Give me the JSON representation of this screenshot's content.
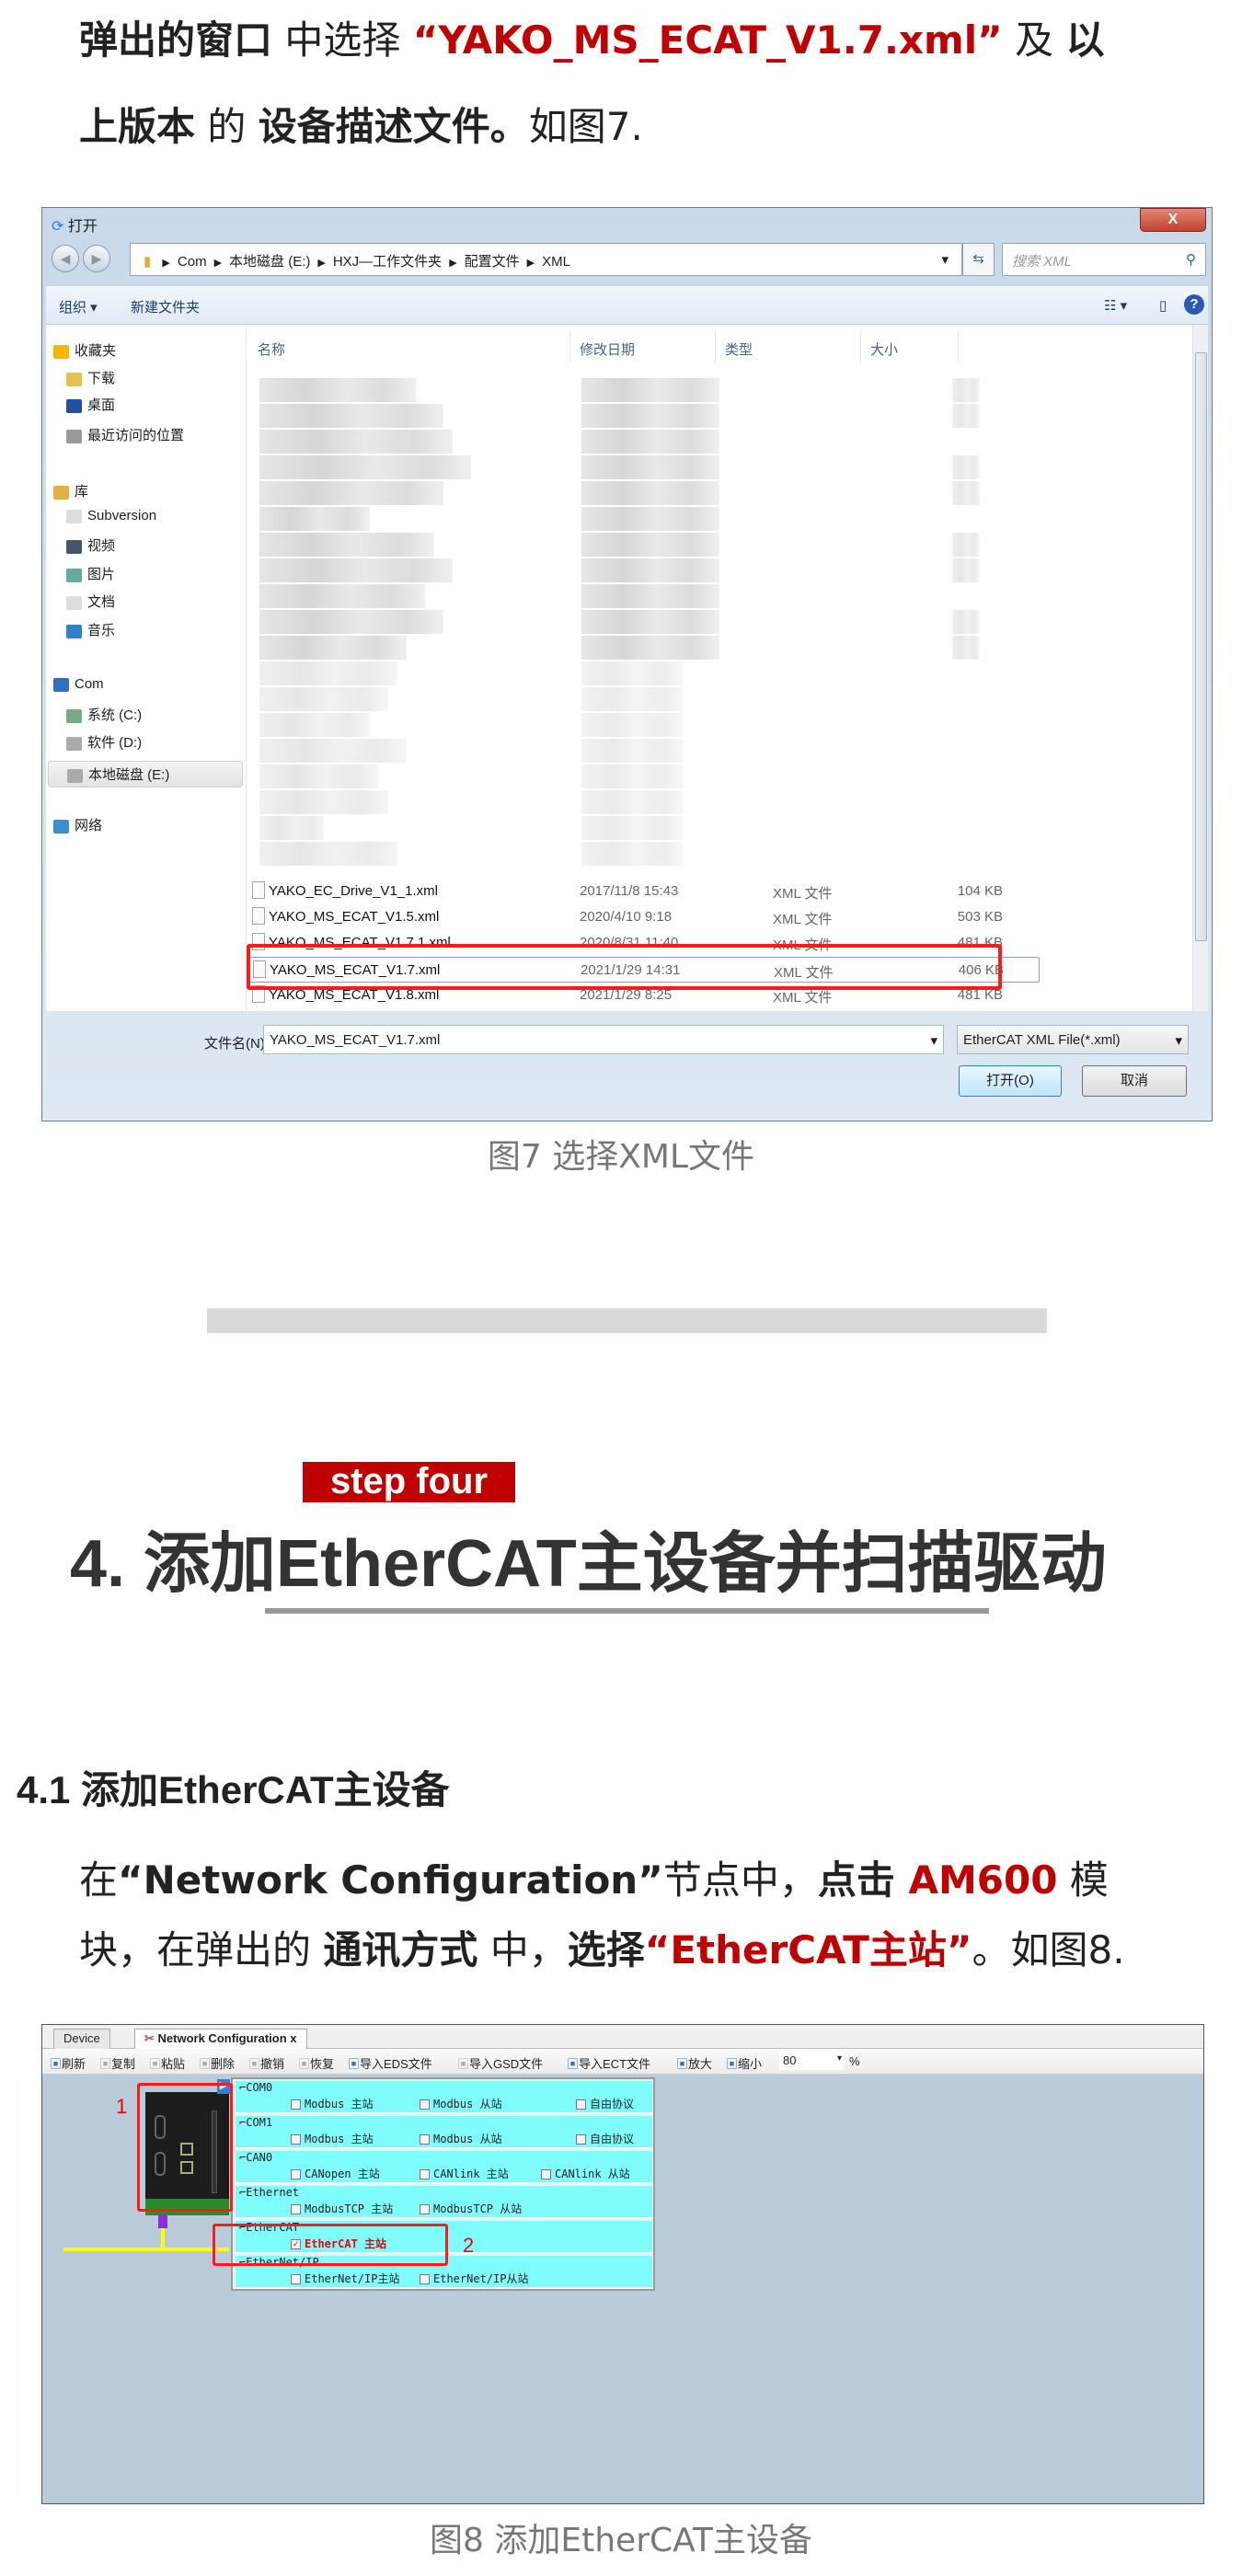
{
  "intro": {
    "line1": [
      {
        "t": "弹出的窗口",
        "s": "b"
      },
      {
        "t": " 中选择 ",
        "s": ""
      },
      {
        "t": "“YAKO_MS_ECAT_V1.7.xml”",
        "s": "red"
      },
      {
        "t": " 及 ",
        "s": ""
      },
      {
        "t": "以",
        "s": "b"
      }
    ],
    "line2": [
      {
        "t": "上版本",
        "s": "b"
      },
      {
        "t": " 的 ",
        "s": ""
      },
      {
        "t": "设备描述文件。",
        "s": "b"
      },
      {
        "t": "如图7.",
        "s": ""
      }
    ]
  },
  "dialog": {
    "title": "打开",
    "close": "X",
    "breadcrumb": [
      "Com",
      "本地磁盘 (E:)",
      "HXJ—工作文件夹",
      "配置文件",
      "XML"
    ],
    "search_placeholder": "搜索 XML",
    "toolbar": {
      "organize": "组织 ▾",
      "new_folder": "新建文件夹"
    },
    "nav": [
      {
        "label": "收藏夹",
        "icon": "star-icon",
        "level": 0
      },
      {
        "label": "下载",
        "icon": "download-folder-icon",
        "level": 1
      },
      {
        "label": "桌面",
        "icon": "desktop-icon",
        "level": 1
      },
      {
        "label": "最近访问的位置",
        "icon": "recent-places-icon",
        "level": 1
      },
      {
        "label": "库",
        "icon": "library-icon",
        "level": 0
      },
      {
        "label": "Subversion",
        "icon": "document-icon",
        "level": 1
      },
      {
        "label": "视频",
        "icon": "video-icon",
        "level": 1
      },
      {
        "label": "图片",
        "icon": "picture-icon",
        "level": 1
      },
      {
        "label": "文档",
        "icon": "document-icon",
        "level": 1
      },
      {
        "label": "音乐",
        "icon": "music-icon",
        "level": 1
      },
      {
        "label": "Com",
        "icon": "computer-icon",
        "level": 0
      },
      {
        "label": "系统 (C:)",
        "icon": "system-drive-icon",
        "level": 1
      },
      {
        "label": "软件 (D:)",
        "icon": "drive-icon",
        "level": 1
      },
      {
        "label": "本地磁盘 (E:)",
        "icon": "drive-icon",
        "level": 1,
        "selected": true
      },
      {
        "label": "网络",
        "icon": "network-icon",
        "level": 0
      }
    ],
    "columns": [
      "名称",
      "修改日期",
      "类型",
      "大小"
    ],
    "files": [
      {
        "name": "YAKO_EC_Drive_V1_1.xml",
        "date": "2017/11/8 15:43",
        "type": "XML 文件",
        "size": "104 KB"
      },
      {
        "name": "YAKO_MS_ECAT_V1.5.xml",
        "date": "2020/4/10 9:18",
        "type": "XML 文件",
        "size": "503 KB"
      },
      {
        "name": "YAKO_MS_ECAT_V1.7.1.xml",
        "date": "2020/8/31 11:40",
        "type": "XML 文件",
        "size": "481 KB"
      },
      {
        "name": "YAKO_MS_ECAT_V1.7.xml",
        "date": "2021/1/29 14:31",
        "type": "XML 文件",
        "size": "406 KB",
        "selected": true
      },
      {
        "name": "YAKO_MS_ECAT_V1.8.xml",
        "date": "2021/1/29 8:25",
        "type": "XML 文件",
        "size": "481 KB"
      }
    ],
    "filename_label": "文件名(N):",
    "filename_value": "YAKO_MS_ECAT_V1.7.xml",
    "filetype": "EtherCAT  XML  File(*.xml)",
    "open": "打开(O)",
    "cancel": "取消"
  },
  "caption7": "图7 选择XML文件",
  "step_label": "step four",
  "heading": "4. 添加EtherCAT主设备并扫描驱动",
  "subheading": "4.1 添加EtherCAT主设备",
  "para": {
    "line1": [
      {
        "t": "在",
        "s": ""
      },
      {
        "t": "“Network Configuration”",
        "s": "b"
      },
      {
        "t": "节点中，",
        "s": ""
      },
      {
        "t": "点击 ",
        "s": "b"
      },
      {
        "t": "AM600",
        "s": "red"
      },
      {
        "t": " 模",
        "s": ""
      }
    ],
    "line2": [
      {
        "t": "块，在弹出的 ",
        "s": ""
      },
      {
        "t": "通讯方式",
        "s": "b"
      },
      {
        "t": " 中，",
        "s": ""
      },
      {
        "t": "选择",
        "s": "b"
      },
      {
        "t": "“EtherCAT主站”",
        "s": "red"
      },
      {
        "t": "。如图8.",
        "s": ""
      }
    ]
  },
  "fig8": {
    "tabs": [
      "Device",
      "Network Configuration"
    ],
    "tab_close": "x",
    "toolbar": [
      {
        "label": "刷新",
        "enabled": true
      },
      {
        "label": "复制",
        "enabled": false
      },
      {
        "label": "粘贴",
        "enabled": false
      },
      {
        "label": "删除",
        "enabled": false
      },
      {
        "label": "撤销",
        "enabled": false
      },
      {
        "label": "恢复",
        "enabled": false
      },
      {
        "label": "导入EDS文件",
        "enabled": true
      },
      {
        "label": "导入GSD文件",
        "enabled": false
      },
      {
        "label": "导入ECT文件",
        "enabled": true
      },
      {
        "label": "放大",
        "enabled": true
      },
      {
        "label": "缩小",
        "enabled": true
      }
    ],
    "zoom": "80",
    "zoom_unit": "%",
    "groups": [
      {
        "name": "COM0",
        "options": [
          {
            "label": "Modbus 主站",
            "checked": false
          },
          {
            "label": "Modbus 从站",
            "checked": false
          },
          {
            "label": "自由协议",
            "checked": false
          }
        ]
      },
      {
        "name": "COM1",
        "options": [
          {
            "label": "Modbus 主站",
            "checked": false
          },
          {
            "label": "Modbus 从站",
            "checked": false
          },
          {
            "label": "自由协议",
            "checked": false
          }
        ]
      },
      {
        "name": "CAN0",
        "options": [
          {
            "label": "CANopen 主站",
            "checked": false
          },
          {
            "label": "CANlink 主站",
            "checked": false
          },
          {
            "label": "CANlink 从站",
            "checked": false
          }
        ]
      },
      {
        "name": "Ethernet",
        "options": [
          {
            "label": "ModbusTCP 主站",
            "checked": false
          },
          {
            "label": "ModbusTCP 从站",
            "checked": false
          }
        ]
      },
      {
        "name": "EtherCAT",
        "options": [
          {
            "label": "EtherCAT 主站",
            "checked": true
          }
        ]
      },
      {
        "name": "EtherNet/IP",
        "options": [
          {
            "label": "EtherNet/IP主站",
            "checked": false
          },
          {
            "label": "EtherNet/IP从站",
            "checked": false
          }
        ]
      }
    ],
    "marker1": "1",
    "marker2": "2"
  },
  "caption8": "图8 添加EtherCAT主设备",
  "colors": {
    "accent_red": "#c00000",
    "highlight_box": "#ff1a1a",
    "canvas": "#b9cad9",
    "panel_cyan": "#7ffcfc"
  }
}
